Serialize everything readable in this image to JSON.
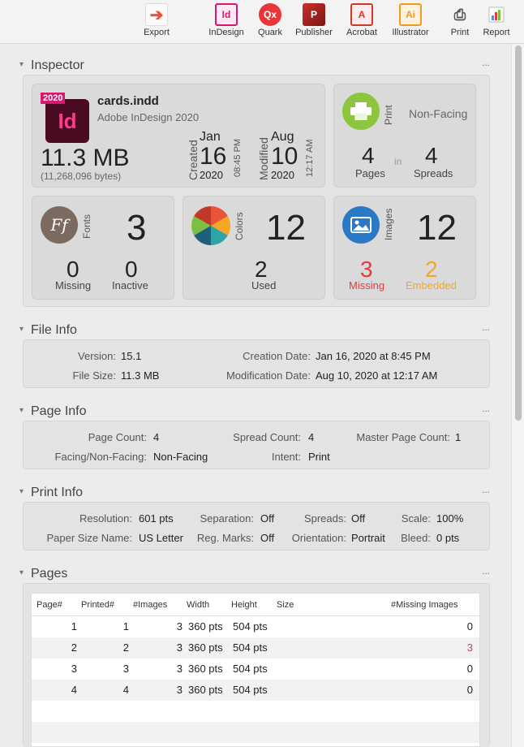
{
  "toolbar": {
    "items": [
      {
        "label": "Export",
        "icon": "export-icon",
        "glyph": "➔"
      },
      {
        "label": "InDesign",
        "icon": "indesign-icon",
        "glyph": "Id"
      },
      {
        "label": "Quark",
        "icon": "quark-icon",
        "glyph": "Qx"
      },
      {
        "label": "Publisher",
        "icon": "publisher-icon",
        "glyph": "P"
      },
      {
        "label": "Acrobat",
        "icon": "acrobat-icon",
        "glyph": "A"
      },
      {
        "label": "Illustrator",
        "icon": "illustrator-icon",
        "glyph": "Ai"
      },
      {
        "label": "Print",
        "icon": "print-icon",
        "glyph": "⎙"
      },
      {
        "label": "Report",
        "icon": "report-icon",
        "glyph": ""
      }
    ]
  },
  "inspector": {
    "title": "Inspector",
    "more": "...",
    "file": {
      "badge": "2020",
      "app_glyph": "Id",
      "name": "cards.indd",
      "app": "Adobe InDesign 2020",
      "size": "11.3 MB",
      "bytes": "(11,268,096 bytes)"
    },
    "created": {
      "label": "Created",
      "month": "Jan",
      "day": "16",
      "year": "2020",
      "time": "08:45 PM"
    },
    "modified": {
      "label": "Modified",
      "month": "Aug",
      "day": "10",
      "year": "2020",
      "time": "12:17 AM"
    },
    "print": {
      "label": "Print",
      "facing": "Non-Facing",
      "pages": "4",
      "pages_label": "Pages",
      "in": "in",
      "spreads": "4",
      "spreads_label": "Spreads"
    },
    "fonts": {
      "label": "Fonts",
      "count": "3",
      "missing": "0",
      "missing_label": "Missing",
      "inactive": "0",
      "inactive_label": "Inactive",
      "glyph": "Ff"
    },
    "colors": {
      "label": "Colors",
      "count": "12",
      "used": "2",
      "used_label": "Used"
    },
    "images": {
      "label": "Images",
      "count": "12",
      "missing": "3",
      "missing_label": "Missing",
      "embedded": "2",
      "embedded_label": "Embedded"
    }
  },
  "file_info": {
    "title": "File Info",
    "more": "...",
    "version_label": "Version:",
    "version": "15.1",
    "filesize_label": "File Size:",
    "filesize": "11.3 MB",
    "creation_label": "Creation Date:",
    "creation": "Jan 16, 2020 at 8:45 PM",
    "modification_label": "Modification Date:",
    "modification": "Aug 10, 2020 at 12:17 AM"
  },
  "page_info": {
    "title": "Page Info",
    "more": "...",
    "page_count_label": "Page Count:",
    "page_count": "4",
    "spread_count_label": "Spread Count:",
    "spread_count": "4",
    "master_label": "Master Page Count:",
    "master": "1",
    "facing_label": "Facing/Non-Facing:",
    "facing": "Non-Facing",
    "intent_label": "Intent:",
    "intent": "Print"
  },
  "print_info": {
    "title": "Print Info",
    "more": "...",
    "resolution_label": "Resolution:",
    "resolution": "601 pts",
    "separation_label": "Separation:",
    "separation": "Off",
    "spreads_label": "Spreads:",
    "spreads": "Off",
    "scale_label": "Scale:",
    "scale": "100%",
    "paper_label": "Paper Size Name:",
    "paper": "US Letter",
    "regmarks_label": "Reg. Marks:",
    "regmarks": "Off",
    "orientation_label": "Orientation:",
    "orientation": "Portrait",
    "bleed_label": "Bleed:",
    "bleed": "0 pts"
  },
  "pages": {
    "title": "Pages",
    "more": "...",
    "columns": [
      "Page#",
      "Printed#",
      "#Images",
      "Width",
      "Height",
      "Size",
      "#Missing Images"
    ],
    "rows": [
      [
        "1",
        "1",
        "3",
        "360 pts",
        "504 pts",
        "",
        "0"
      ],
      [
        "2",
        "2",
        "3",
        "360 pts",
        "504 pts",
        "",
        "3"
      ],
      [
        "3",
        "3",
        "3",
        "360 pts",
        "504 pts",
        "",
        "0"
      ],
      [
        "4",
        "4",
        "3",
        "360 pts",
        "504 pts",
        "",
        "0"
      ]
    ]
  },
  "colors": {
    "accent_red": "#e8393a",
    "accent_orange": "#f5a623",
    "indesign": "#d6196e"
  }
}
